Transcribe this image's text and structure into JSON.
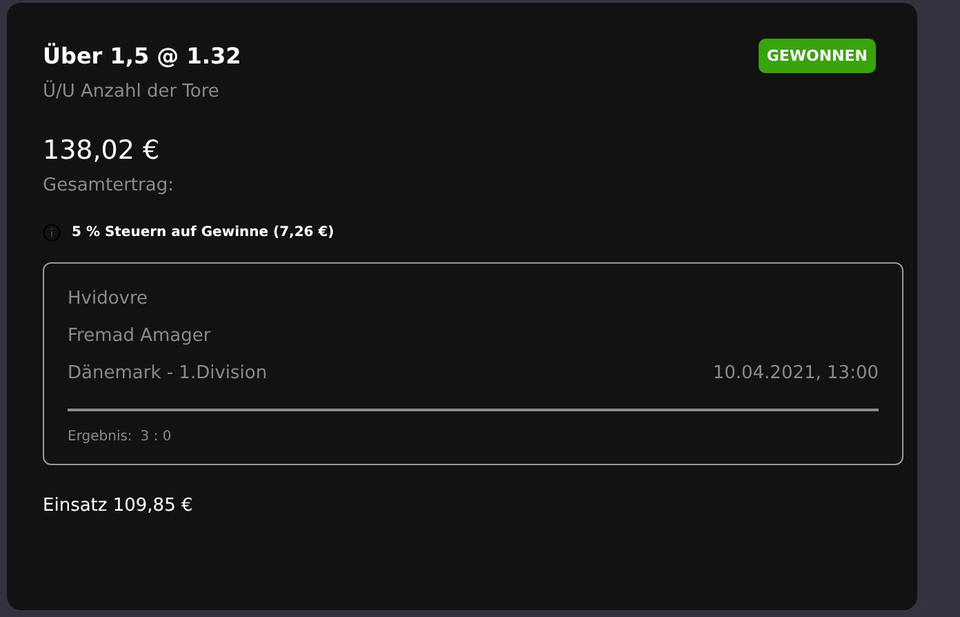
{
  "bet": {
    "title": "Über 1,5 @ 1.32",
    "market": "Ü/U Anzahl der Tore",
    "status": {
      "label": "GEWONNEN",
      "kind": "won"
    }
  },
  "payout": {
    "amount": "138,02 €",
    "label": "Gesamtertrag:"
  },
  "tax_note": "5 % Steuern auf Gewinne (7,26 €)",
  "event": {
    "home": "Hvidovre",
    "away": "Fremad Amager",
    "league": "Dänemark - 1.Division",
    "datetime": "10.04.2021, 13:00",
    "result_label": "Ergebnis:",
    "result": "3 : 0"
  },
  "stake": "Einsatz 109,85 €"
}
